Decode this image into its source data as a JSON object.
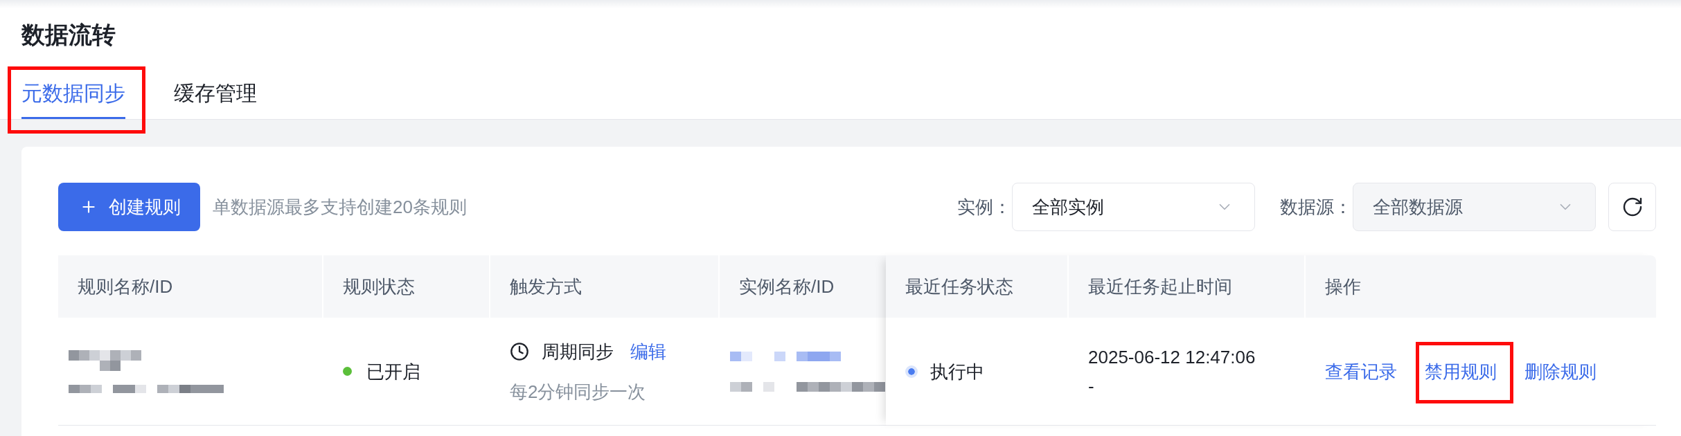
{
  "page": {
    "title": "数据流转"
  },
  "tabs": [
    {
      "label": "元数据同步",
      "selected": true,
      "highlighted": true
    },
    {
      "label": "缓存管理",
      "selected": false,
      "highlighted": false
    }
  ],
  "toolbar": {
    "create_button": {
      "label": "创建规则"
    },
    "hint": "单数据源最多支持创建20条规则",
    "filters": [
      {
        "label": "实例：",
        "value": "全部实例",
        "disabled": false
      },
      {
        "label": "数据源：",
        "value": "全部数据源",
        "disabled": true
      }
    ]
  },
  "table": {
    "scroll_area": {
      "columns": [
        "规则名称/ID",
        "规则状态",
        "触发方式",
        "实例名称/ID"
      ],
      "rows": [
        {
          "cells": [
            {
              "kind": "redacted"
            },
            {
              "kind": "status",
              "label": "已开启",
              "color": "#5bbf3a",
              "halo": false
            },
            {
              "kind": "trigger",
              "label": "周期同步",
              "link": "编辑",
              "note": "每2分钟同步一次"
            },
            {
              "kind": "redacted_link"
            }
          ]
        }
      ]
    },
    "pinned_area": {
      "columns": [
        "最近任务状态",
        "最近任务起止时间",
        "操作"
      ],
      "rows": [
        {
          "cells": [
            {
              "kind": "status",
              "label": "执行中",
              "color": "#4a7cf0",
              "halo": true
            },
            {
              "kind": "time_range",
              "start": "2025-06-12 12:47:06",
              "end": "-"
            },
            {
              "kind": "actions",
              "items": [
                {
                  "label": "查看记录",
                  "highlighted": false
                },
                {
                  "label": "禁用规则",
                  "highlighted": true
                },
                {
                  "label": "删除规则",
                  "highlighted": false
                }
              ]
            }
          ]
        }
      ]
    }
  }
}
